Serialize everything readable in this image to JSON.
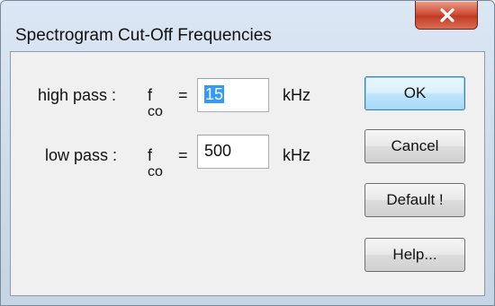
{
  "window": {
    "title": "Spectrogram Cut-Off Frequencies",
    "close_icon": "close-x-icon"
  },
  "fields": {
    "high_pass": {
      "label": "high pass :",
      "symbol": "f",
      "subscript": "co",
      "equals": "=",
      "value": "15",
      "unit": "kHz"
    },
    "low_pass": {
      "label": "low pass :",
      "symbol": "f",
      "subscript": "co",
      "equals": "=",
      "value": "500",
      "unit": "kHz"
    }
  },
  "buttons": {
    "ok": "OK",
    "cancel": "Cancel",
    "default": "Default !",
    "help": "Help..."
  },
  "colors": {
    "selection": "#3399ff",
    "close_button": "#c23a24",
    "default_button_border": "#3c7fb1"
  }
}
